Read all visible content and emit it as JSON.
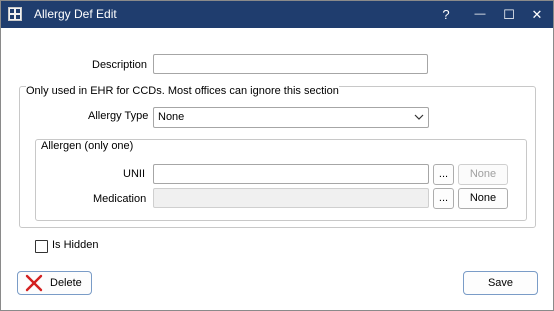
{
  "window": {
    "title": "Allergy Def Edit",
    "help": "?",
    "minimize": "—",
    "maximize": "☐",
    "close": "✕"
  },
  "form": {
    "description_label": "Description",
    "description_value": "",
    "ehr_section_label": "Only used in EHR for CCDs.  Most offices can ignore this section",
    "allergy_type_label": "Allergy Type",
    "allergy_type_value": "None",
    "allergen_group_label": "Allergen (only one)",
    "unii_label": "UNII",
    "unii_value": "",
    "unii_browse": "...",
    "unii_none": "None",
    "medication_label": "Medication",
    "medication_value": "",
    "medication_browse": "...",
    "medication_none": "None",
    "is_hidden_label": "Is Hidden",
    "is_hidden_checked": false
  },
  "footer": {
    "delete_label": "Delete",
    "save_label": "Save"
  },
  "colors": {
    "titlebar": "#1f3d6e",
    "delete_x": "#d32020"
  }
}
